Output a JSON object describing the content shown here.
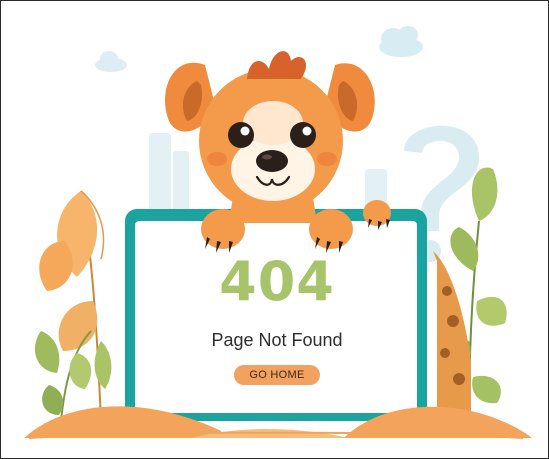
{
  "error": {
    "code": "404",
    "message": "Page Not Found",
    "button_label": "GO HOME"
  },
  "colors": {
    "code_green": "#a8c46a",
    "button_orange": "#f2a15e",
    "sign_border_teal": "#1ba3a0",
    "dog_orange": "#f08a3c"
  },
  "icons": [
    "dog-mascot",
    "cloud-icon",
    "question-mark-icon",
    "leaf-plant-icon",
    "giraffe-icon"
  ]
}
